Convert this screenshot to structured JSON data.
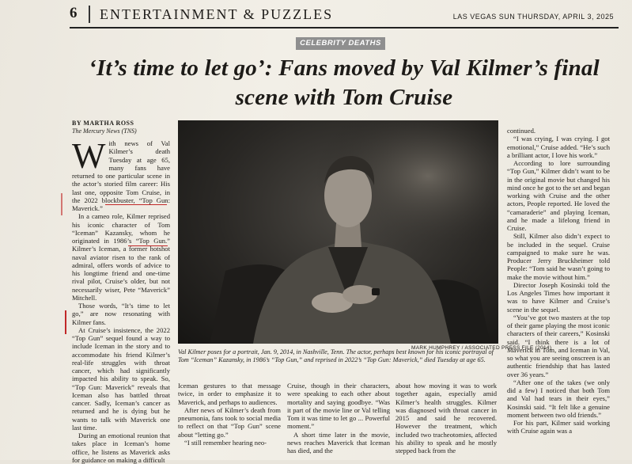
{
  "header": {
    "page_number": "6",
    "section": "ENTERTAINMENT & PUZZLES",
    "dateline": "LAS VEGAS SUN   THURSDAY, APRIL 3, 2025"
  },
  "badge": "CELEBRITY DEATHS",
  "headline": "‘It’s time to let go’: Fans moved by Val Kilmer’s final scene with Tom Cruise",
  "byline": "BY MARTHA ROSS",
  "source": "The Mercury News (TNS)",
  "photo": {
    "credit": "MARK HUMPHREY / ASSOCIATED PRESS FILE (2014)",
    "caption": "Val Kilmer poses for a portrait, Jan. 9, 2014, in Nashville, Tenn. The actor, perhaps best known for his iconic portrayal of Tom “Iceman” Kazansky, in 1986’s “Top Gun,” and reprised in 2022’s “Top Gun: Maverick,” died Tuesday at age 65."
  },
  "dropcap": "W",
  "col1": [
    "ith news of Val Kilmer’s death Tuesday at age 65, many fans have returned to one particular scene in the actor’s storied film career: His last one, opposite Tom Cruise, in the 2022 blockbuster, “Top Gun: Maverick.”",
    "In a cameo role, Kilmer reprised his iconic character of Tom “Iceman” Kazansky, whom he originated in 1986’s “Top Gun.” Kilmer’s Iceman, a former hotshot naval aviator risen to the rank of admiral, offers words of advice to his longtime friend and one-time rival pilot, Cruise’s older, but not necessarily wiser, Pete “Maverick” Mitchell.",
    "Those words, “It’s time to let go,” are now resonating with Kilmer fans.",
    "At Cruise’s insistence, the 2022 “Top Gun” sequel found a way to include Iceman in the story and to accommodate his friend Kilmer’s real-life struggles with throat cancer, which had significantly impacted his ability to speak. So, “Top Gun: Maverick” reveals that Iceman also has battled throat cancer. Sadly, Iceman’s cancer as returned and he is dying but he wants to talk with Maverick one last time.",
    "During an emotional reunion that takes place in Iceman’s home office, he listens as Maverick asks for guidance on making a difficult"
  ],
  "col2": [
    "Iceman gestures to that message twice, in order to emphasize it to Maverick, and perhaps to audiences.",
    "After news of Kilmer’s death from pneumonia, fans took to social media to reflect on that “Top Gun” scene about “letting go.”",
    "“I still remember hearing neo-"
  ],
  "col3": [
    "Cruise, though in their characters, were speaking to each other about mortality and saying goodbye. “Was it part of the movie line or Val telling Tom it was time to let go ... Powerful moment.”",
    "A short time later in the movie, news reaches Maverick that Iceman has died, and the"
  ],
  "col4": [
    "about how moving it was to work together again, especially amid Kilmer’s health struggles. Kilmer was diagnosed with throat cancer in 2015 and said he recovered. However the treatment, which included two tracheotomies, affected his ability to speak and he mostly stepped back from the"
  ],
  "col5": [
    "continued.",
    "“I was crying, I was crying. I got emotional,” Cruise added. “He’s such a brilliant actor, I love his work.”",
    "According to lore surrounding “Top Gun,” Kilmer didn’t want to be in the original movie but changed his mind once he got to the set and began working with Cruise and the other actors, People reported. He loved the “camaraderie” and playing Iceman, and he made a lifelong friend in Cruise.",
    "Still, Kilmer also didn’t expect to be included in the sequel. Cruise campaigned to make sure he was. Producer Jerry Bruckheimer told People: “Tom said he wasn’t going to make the movie without him.”",
    "Director Joseph Kosinski told the Los Angeles Times how important it was to have Kilmer and Cruise’s scene in the sequel.",
    "“You’ve got two masters at the top of their game playing the most iconic characters of their careers,” Kosinski said. “I think there is a lot of Maverick in Tom, and Iceman in Val, so what you are seeing onscreen is an authentic friendship that has lasted over 36 years.”",
    "“After one of the takes (we only did a few) I noticed that both Tom and Val had tears in their eyes,” Kosinski said. “It felt like a genuine moment between two old friends.”",
    "For his part, Kilmer said working with Cruise again was a"
  ]
}
